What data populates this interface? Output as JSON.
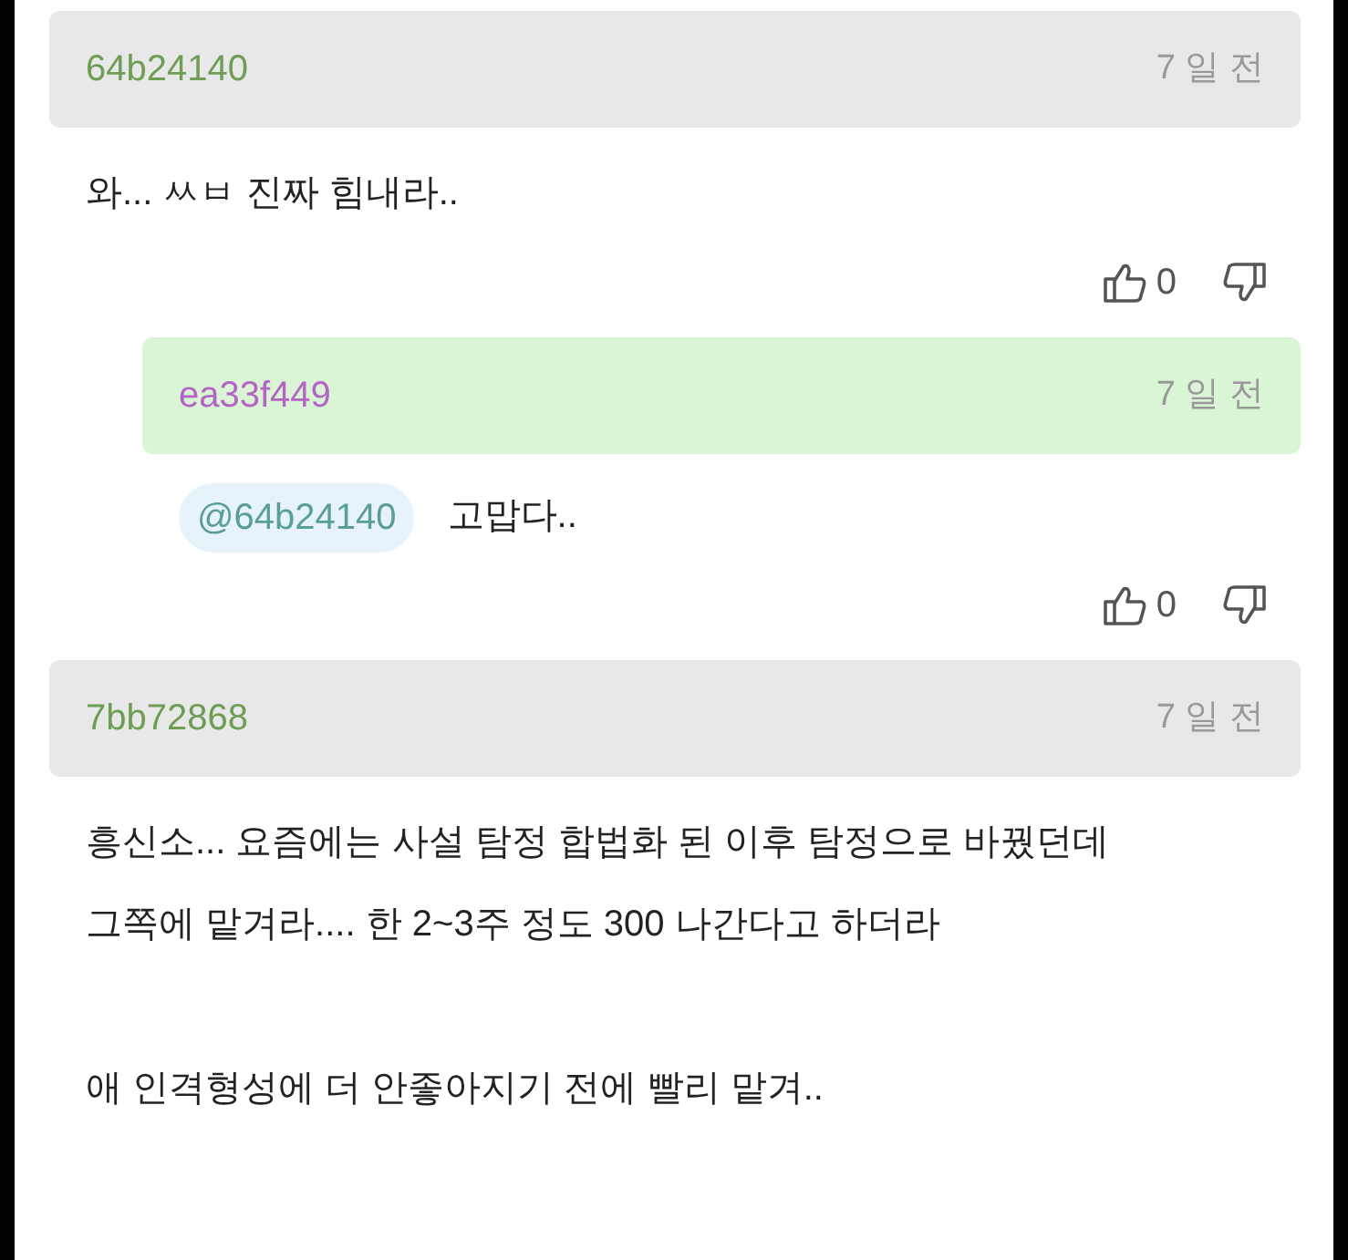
{
  "comments": [
    {
      "kind": "comment",
      "author": "64b24140",
      "color": "#6e9e55",
      "time": "7 일 전",
      "body": "와... ㅆㅂ 진짜 힘내라..",
      "likes": "0"
    },
    {
      "kind": "reply",
      "author": "ea33f449",
      "color": "#b464c4",
      "time": "7 일 전",
      "mention": "@64b24140",
      "body": "고맙다..",
      "likes": "0"
    },
    {
      "kind": "comment",
      "author": "7bb72868",
      "color": "#6e9e55",
      "time": "7 일 전",
      "body": "흥신소... 요즘에는 사설 탐정 합법화 된 이후 탐정으로 바꿨던데\n그쪽에 맡겨라.... 한 2~3주 정도 300 나간다고 하더라\n\n애 인격형성에 더 안좋아지기 전에 빨리 맡겨.."
    }
  ]
}
